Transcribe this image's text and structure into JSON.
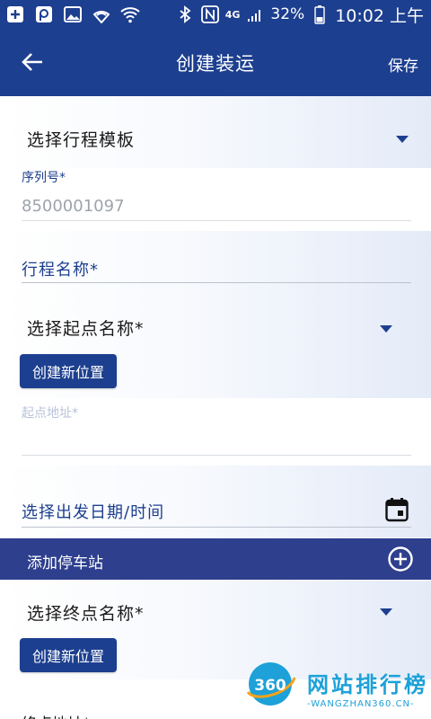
{
  "status_bar": {
    "battery": "32%",
    "time": "10:02 上午",
    "network": "4G"
  },
  "appbar": {
    "title": "创建装运",
    "save_label": "保存"
  },
  "form": {
    "trip_template_label": "选择行程模板",
    "serial_label": "序列号*",
    "serial_value": "8500001097",
    "trip_name_label": "行程名称*",
    "start_name_label": "选择起点名称*",
    "create_location_label": "创建新位置",
    "start_address_label": "起点地址*",
    "departure_label": "选择出发日期/时间",
    "add_stop_label": "添加停车站",
    "end_name_label": "选择终点名称*",
    "create_location_label_2": "创建新位置",
    "end_address_label": "终点地址*"
  },
  "watermark": {
    "number": "360",
    "text": "网站排行榜",
    "sub": "-WANGZHAN360.CN-"
  },
  "colors": {
    "primary": "#1d3f8f",
    "stops_bar": "#2e3f8e"
  }
}
